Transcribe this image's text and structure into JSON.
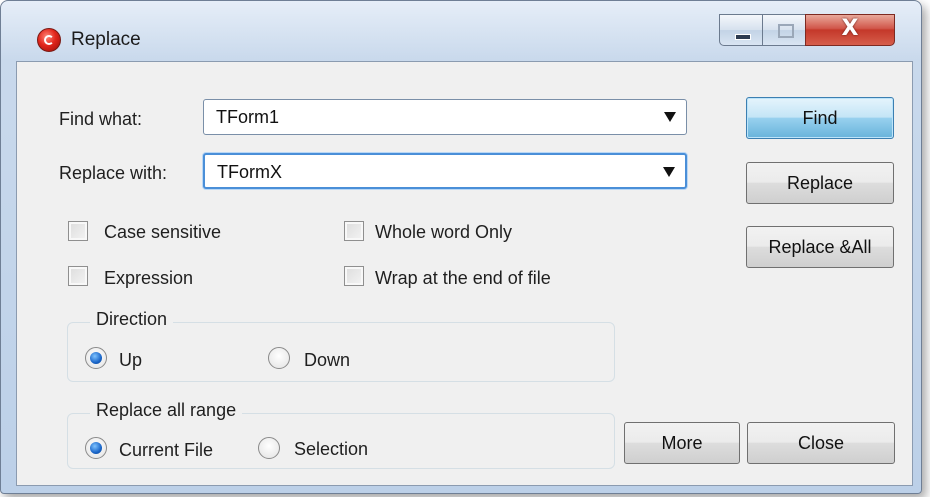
{
  "window": {
    "title": "Replace",
    "icon": "app-icon",
    "controls": {
      "minimize": "minimize-icon",
      "maximize": "maximize-icon",
      "close_glyph": "X"
    }
  },
  "find": {
    "label": "Find what:",
    "value": "TForm1"
  },
  "replace": {
    "label": "Replace with:",
    "value": "TFormX"
  },
  "options": {
    "case_sensitive": {
      "label": "Case sensitive",
      "checked": false
    },
    "whole_word": {
      "label": "Whole word Only",
      "checked": false
    },
    "expression": {
      "label": "Expression",
      "checked": false
    },
    "wrap": {
      "label": "Wrap at the end of file",
      "checked": false
    }
  },
  "direction": {
    "title": "Direction",
    "up": {
      "label": "Up",
      "selected": true
    },
    "down": {
      "label": "Down",
      "selected": false
    }
  },
  "range": {
    "title": "Replace all range",
    "current_file": {
      "label": "Current File",
      "selected": true
    },
    "selection": {
      "label": "Selection",
      "selected": false
    }
  },
  "buttons": {
    "find": "Find",
    "replace": "Replace",
    "replace_all": "Replace &All",
    "more": "More",
    "close": "Close"
  },
  "colors": {
    "default_button": "#98d1ef",
    "close_button": "#c4382a",
    "radio_selected": "#1a66c9",
    "focus_border": "#4a8fd8"
  }
}
